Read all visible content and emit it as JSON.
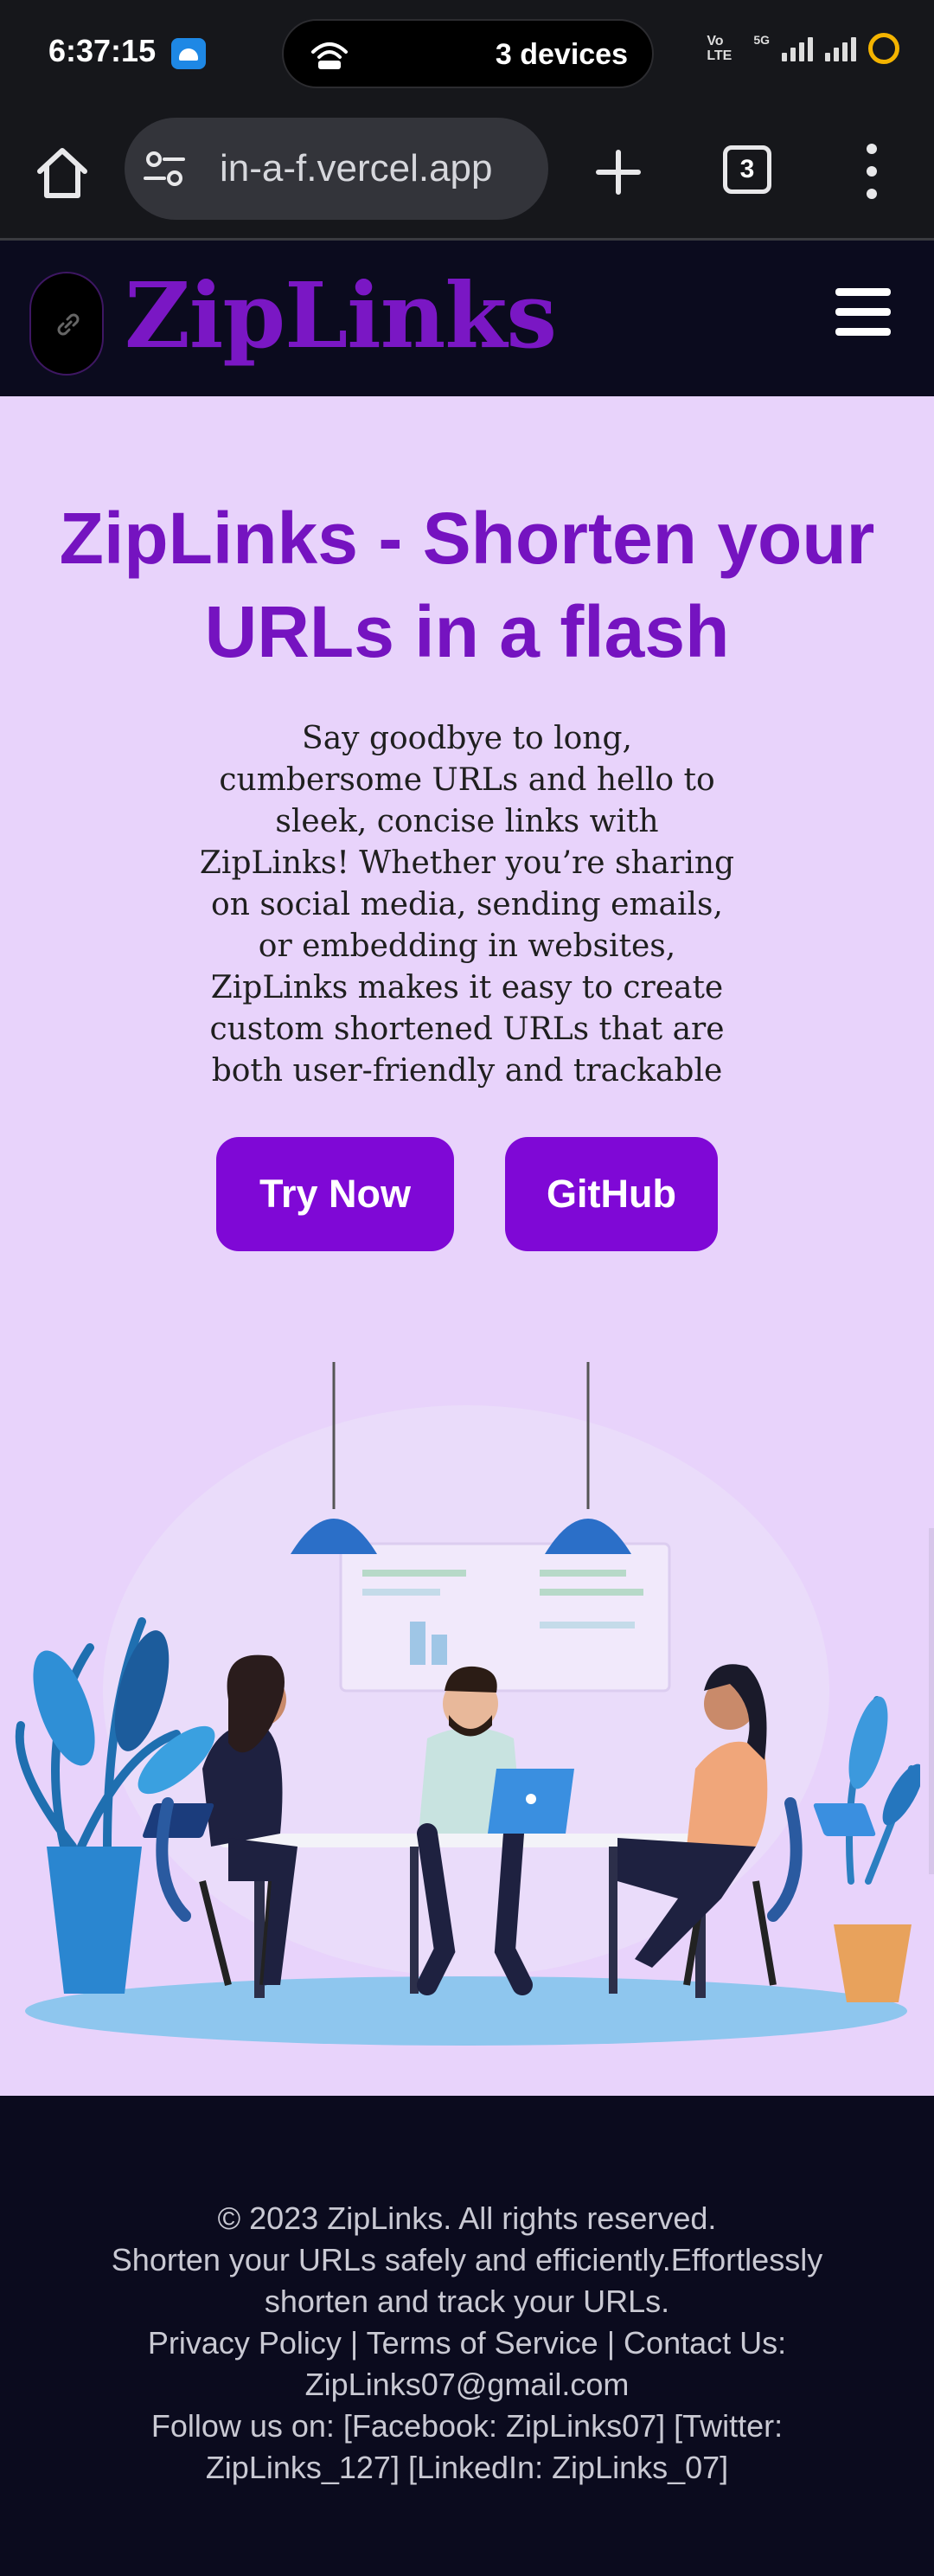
{
  "status_bar": {
    "time": "6:37:15",
    "hotspot_label": "3 devices",
    "network_label": "Vo LTE",
    "network_type": "5G"
  },
  "browser": {
    "url": "in-a-f.vercel.app",
    "tab_count": "3"
  },
  "header": {
    "brand": "ZipLinks"
  },
  "hero": {
    "title": "ZipLinks - Shorten your URLs in a flash",
    "description": "Say goodbye to long, cumbersome URLs and hello to sleek, concise links with ZipLinks! Whether you’re sharing on social media, sending emails, or embedding in websites, ZipLinks makes it easy to create custom shortened URLs that are both user-friendly and trackable",
    "try_now_label": "Try Now",
    "github_label": "GitHub"
  },
  "footer": {
    "copyright": "© 2023 ZipLinks. All rights reserved.",
    "tagline": "Shorten your URLs safely and efficiently.Effortlessly shorten and track your URLs.",
    "links": "Privacy Policy | Terms of Service | Contact Us: ZipLinks07@gmail.com",
    "social": "Follow us on: [Facebook: ZipLinks07] [Twitter: ZipLinks_127] [LinkedIn: ZipLinks_07]"
  },
  "colors": {
    "brand_purple": "#7a17c4",
    "button_purple": "#7f08d6",
    "hero_background": "#e8d3fb",
    "dark_background": "#0b0b1e"
  },
  "icons": {
    "home": "home-icon",
    "site_settings": "tune-icon",
    "new_tab": "plus-icon",
    "menu": "more-vert-icon",
    "hamburger": "hamburger-icon",
    "logo": "link-icon"
  }
}
